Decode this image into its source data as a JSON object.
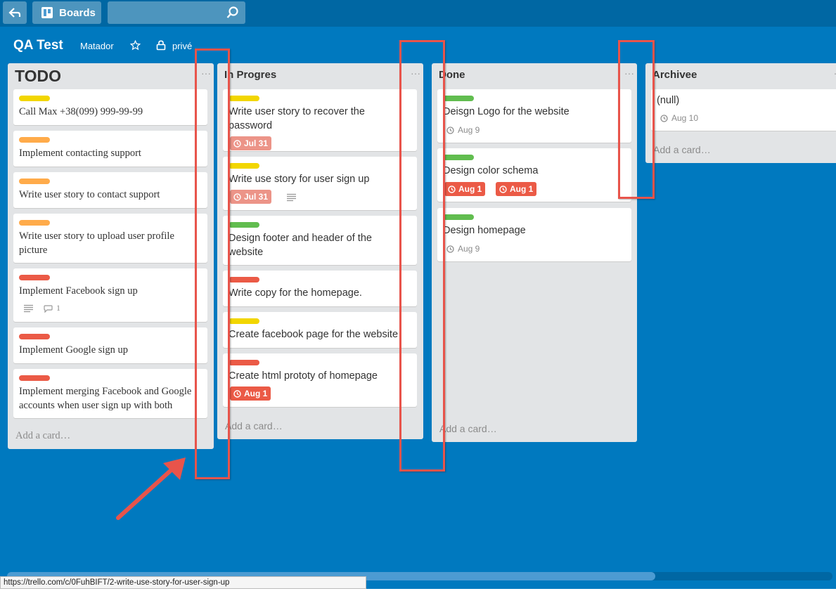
{
  "header": {
    "boards_label": "Boards"
  },
  "board": {
    "title": "QA Test",
    "team": "Matador",
    "visibility": "privé"
  },
  "colors": {
    "yellow": "#f2d600",
    "orange": "#ffab4a",
    "red": "#eb5a46",
    "green": "#61bd4f",
    "badge_red": "#eb5a46",
    "badge_light": "#ec9488"
  },
  "lists": [
    {
      "title": "TODO",
      "add_card": "Add a card…",
      "cards": [
        {
          "label": "yellow",
          "text": "Call Max +38(099) 999-99-99"
        },
        {
          "label": "orange",
          "text": "Implement contacting support"
        },
        {
          "label": "orange",
          "text": "Write user story to contact support"
        },
        {
          "label": "orange",
          "text": "Write user story to upload user profile picture"
        },
        {
          "label": "red",
          "text": "Implement Facebook sign up",
          "comments": "1"
        },
        {
          "label": "red",
          "text": "Implement Google sign up"
        },
        {
          "label": "red",
          "text": "Implement merging Facebook and Google accounts when user sign up with both"
        }
      ]
    },
    {
      "title": "In Progres",
      "add_card": "Add a card…",
      "cards": [
        {
          "label": "yellow",
          "text": "Write user story to recover the password",
          "due": "Jul 31"
        },
        {
          "label": "yellow",
          "text": "Write use story for user sign up",
          "due": "Jul 31"
        },
        {
          "label": "green",
          "text": "Design footer and header of the website"
        },
        {
          "label": "red",
          "text": "Write copy for the homepage."
        },
        {
          "label": "yellow",
          "text": "Create facebook page for the website"
        },
        {
          "label": "red",
          "text": "Create html prototy of homepage",
          "due": "Aug 1"
        }
      ]
    },
    {
      "title": "Done",
      "add_card": "Add a card…",
      "cards": [
        {
          "label": "green",
          "text": "Deisgn Logo for the website",
          "due": "Aug 9"
        },
        {
          "label": "green",
          "text": "Design color schema",
          "due": "Aug 1",
          "due2": "Aug 1"
        },
        {
          "label": "green",
          "text": "Design homepage",
          "due": "Aug 9"
        }
      ]
    },
    {
      "title": "Archivee",
      "add_card": "Add a card…",
      "cards": [
        {
          "text": "(null)",
          "due": "Aug 10"
        }
      ]
    }
  ],
  "status_bar": {
    "url": "https://trello.com/c/0FuhBIFT/2-write-use-story-for-user-sign-up"
  }
}
